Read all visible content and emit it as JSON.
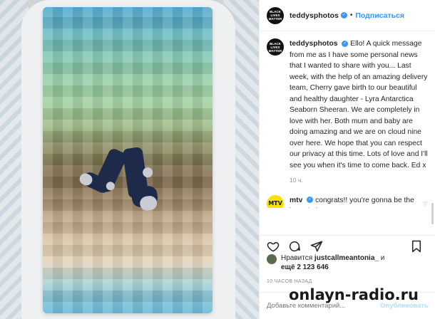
{
  "post": {
    "username": "teddysphotos",
    "follow_label": "Подписаться",
    "avatar_text": "BLACK LIVES MATTER",
    "caption": "Ello! A quick message from me as I have some personal news that I wanted to share with you... Last week, with the help of an amazing delivery team, Cherry gave birth to our beautiful and healthy daughter - Lyra Antarctica Seaborn Sheeran. We are completely in love with her. Both mum and baby are doing amazing and we are on cloud nine over here. We hope that you can respect our privacy at this time. Lots of love and I'll see you when it's time to come back. Ed x",
    "caption_time": "10 ч."
  },
  "comment": {
    "username": "mtv",
    "avatar_text": "MTV",
    "text": "congrats!! you're gonna be the best dad ever",
    "hearts": "❤❤❤"
  },
  "likes": {
    "prefix": "Нравится",
    "user": "justcallmeantonia_",
    "mid": "и",
    "count": "ещё 2 123 646"
  },
  "date": "10 ЧАСОВ НАЗАД",
  "compose": {
    "placeholder": "Добавьте комментарий...",
    "publish_label": "Опубликовать"
  },
  "watermark": "onlayn-radio.ru",
  "colors": {
    "accent": "#3897f0",
    "mtv": "#f5e200",
    "heart": "#e0245e"
  }
}
